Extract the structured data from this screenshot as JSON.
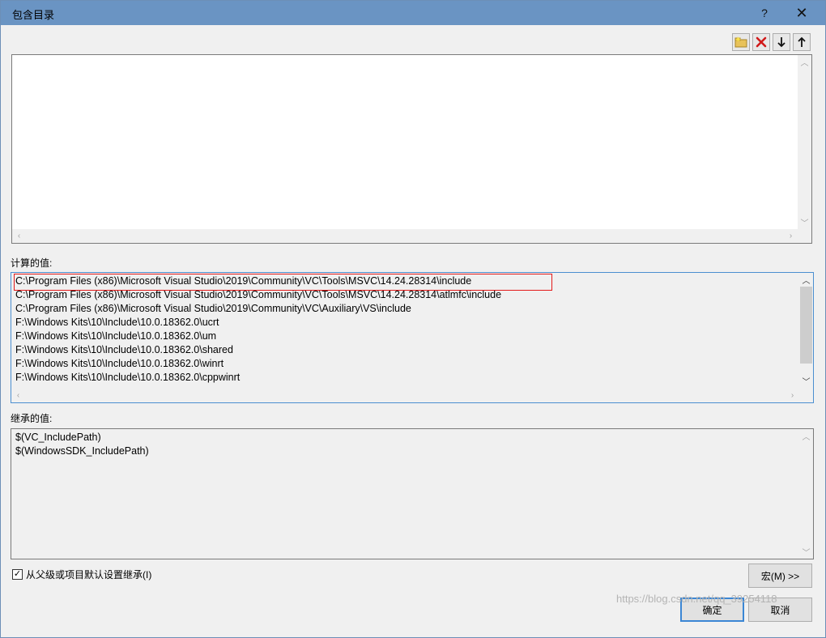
{
  "window": {
    "title": "包含目录",
    "help_label": "?",
    "close_label": "✕"
  },
  "toolbar": {
    "icons": [
      "new-folder-icon",
      "delete-icon",
      "move-down-icon",
      "move-up-icon"
    ]
  },
  "editor": {
    "lines": []
  },
  "evaluated": {
    "label": "计算的值:",
    "rows": [
      "C:\\Program Files (x86)\\Microsoft Visual Studio\\2019\\Community\\VC\\Tools\\MSVC\\14.24.28314\\include",
      "C:\\Program Files (x86)\\Microsoft Visual Studio\\2019\\Community\\VC\\Tools\\MSVC\\14.24.28314\\atlmfc\\include",
      "C:\\Program Files (x86)\\Microsoft Visual Studio\\2019\\Community\\VC\\Auxiliary\\VS\\include",
      "F:\\Windows Kits\\10\\Include\\10.0.18362.0\\ucrt",
      "F:\\Windows Kits\\10\\Include\\10.0.18362.0\\um",
      "F:\\Windows Kits\\10\\Include\\10.0.18362.0\\shared",
      "F:\\Windows Kits\\10\\Include\\10.0.18362.0\\winrt",
      "F:\\Windows Kits\\10\\Include\\10.0.18362.0\\cppwinrt"
    ],
    "highlighted_row": 0
  },
  "inherited": {
    "label": "继承的值:",
    "rows": [
      "$(VC_IncludePath)",
      "$(WindowsSDK_IncludePath)"
    ]
  },
  "inherit_checkbox": {
    "label": "从父级或项目默认设置继承(I)",
    "checked": true
  },
  "buttons": {
    "macros": "宏(M) >>",
    "ok": "确定",
    "cancel": "取消"
  },
  "watermark": "https://blog.csdn.net/qq_39254118",
  "colors": {
    "titlebar": "#6a94c3",
    "highlight_box": "#e31a1a",
    "default_button_border": "#3b86d4"
  }
}
